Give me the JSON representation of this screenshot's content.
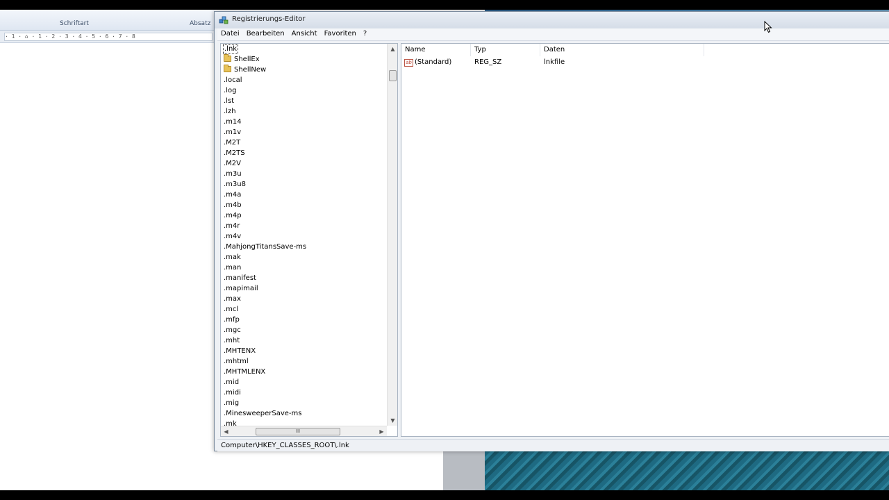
{
  "background_app": {
    "ribbon_groups": [
      "Schriftart",
      "Absatz"
    ],
    "ruler_text": "· 1 · ⌂ · 1 · 2 · 3 · 4 · 5 · 6 · 7 · 8"
  },
  "window": {
    "title": "Registrierungs-Editor"
  },
  "menu": {
    "items": [
      "Datei",
      "Bearbeiten",
      "Ansicht",
      "Favoriten",
      "?"
    ]
  },
  "tree": {
    "selected": ".lnk",
    "items": [
      {
        "label": ".lnk",
        "type": "key",
        "selected": true
      },
      {
        "label": "ShellEx",
        "type": "folder"
      },
      {
        "label": "ShellNew",
        "type": "folder"
      },
      {
        "label": ".local",
        "type": "key"
      },
      {
        "label": ".log",
        "type": "key"
      },
      {
        "label": ".lst",
        "type": "key"
      },
      {
        "label": ".lzh",
        "type": "key"
      },
      {
        "label": ".m14",
        "type": "key"
      },
      {
        "label": ".m1v",
        "type": "key"
      },
      {
        "label": ".M2T",
        "type": "key"
      },
      {
        "label": ".M2TS",
        "type": "key"
      },
      {
        "label": ".M2V",
        "type": "key"
      },
      {
        "label": ".m3u",
        "type": "key"
      },
      {
        "label": ".m3u8",
        "type": "key"
      },
      {
        "label": ".m4a",
        "type": "key"
      },
      {
        "label": ".m4b",
        "type": "key"
      },
      {
        "label": ".m4p",
        "type": "key"
      },
      {
        "label": ".m4r",
        "type": "key"
      },
      {
        "label": ".m4v",
        "type": "key"
      },
      {
        "label": ".MahjongTitansSave-ms",
        "type": "key"
      },
      {
        "label": ".mak",
        "type": "key"
      },
      {
        "label": ".man",
        "type": "key"
      },
      {
        "label": ".manifest",
        "type": "key"
      },
      {
        "label": ".mapimail",
        "type": "key"
      },
      {
        "label": ".max",
        "type": "key"
      },
      {
        "label": ".mcl",
        "type": "key"
      },
      {
        "label": ".mfp",
        "type": "key"
      },
      {
        "label": ".mgc",
        "type": "key"
      },
      {
        "label": ".mht",
        "type": "key"
      },
      {
        "label": ".MHTENX",
        "type": "key"
      },
      {
        "label": ".mhtml",
        "type": "key"
      },
      {
        "label": ".MHTMLENX",
        "type": "key"
      },
      {
        "label": ".mid",
        "type": "key"
      },
      {
        "label": ".midi",
        "type": "key"
      },
      {
        "label": ".mig",
        "type": "key"
      },
      {
        "label": ".MinesweeperSave-ms",
        "type": "key"
      },
      {
        "label": ".mk",
        "type": "key"
      }
    ]
  },
  "values": {
    "columns": [
      "Name",
      "Typ",
      "Daten"
    ],
    "rows": [
      {
        "name": "(Standard)",
        "type": "REG_SZ",
        "data": "lnkfile",
        "icon": "string-value-icon"
      }
    ]
  },
  "scroll": {
    "h_thumb_grip": "III"
  },
  "status": {
    "path": "Computer\\HKEY_CLASSES_ROOT\\.lnk"
  },
  "colors": {
    "selection_outline": "#333333",
    "window_frame": "#7a8a9c",
    "desktop": "#1e6a82"
  }
}
